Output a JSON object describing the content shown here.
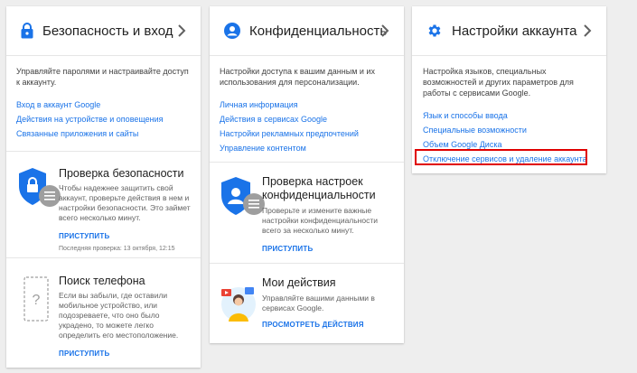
{
  "card1": {
    "title": "Безопасность и вход",
    "desc": "Управляйте паролями и настраивайте доступ к аккаунту.",
    "links": [
      "Вход в аккаунт Google",
      "Действия на устройстве и оповещения",
      "Связанные приложения и сайты"
    ],
    "check": {
      "title": "Проверка безопасности",
      "text": "Чтобы надежнее защитить свой аккаунт, проверьте действия в нем и настройки безопасности. Это займет всего несколько минут.",
      "action": "ПРИСТУПИТЬ",
      "note": "Последняя проверка: 13 октября, 12:15"
    },
    "phone": {
      "title": "Поиск телефона",
      "text": "Если вы забыли, где оставили мобильное устройство, или подозреваете, что оно было украдено, то можете легко определить его местоположение.",
      "action": "ПРИСТУПИТЬ"
    }
  },
  "card2": {
    "title": "Конфиденциальность",
    "desc": "Настройки доступа к вашим данным и их использования для персонализации.",
    "links": [
      "Личная информация",
      "Действия в сервисах Google",
      "Настройки рекламных предпочтений",
      "Управление контентом"
    ],
    "check": {
      "title": "Проверка настроек конфиденциальности",
      "text": "Проверьте и измените важные настройки конфиденциальности всего за несколько минут.",
      "action": "ПРИСТУПИТЬ"
    },
    "activity": {
      "title": "Мои действия",
      "text": "Управляйте вашими данными в сервисах Google.",
      "action": "ПРОСМОТРЕТЬ ДЕЙСТВИЯ"
    }
  },
  "card3": {
    "title": "Настройки аккаунта",
    "desc": "Настройка языков, специальных возможностей и других параметров для работы с сервисами Google.",
    "links": [
      "Язык и способы ввода",
      "Специальные возможности",
      "Объем Google Диска",
      "Отключение сервисов и удаление аккаунта"
    ]
  },
  "colors": {
    "accent": "#1a73e8",
    "highlight": "#e00000",
    "background": "#eeeeee"
  }
}
